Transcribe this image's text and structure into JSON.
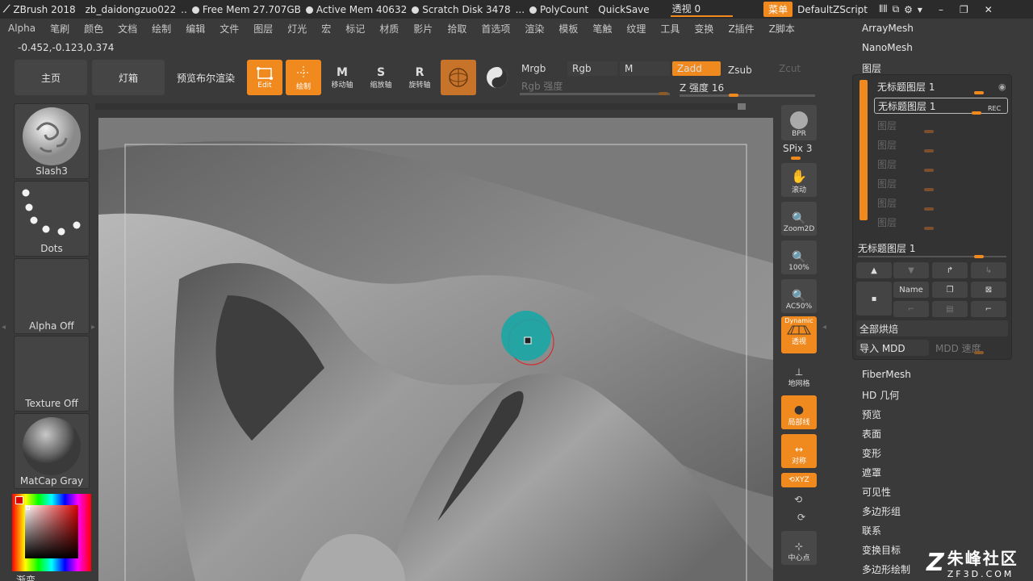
{
  "titlebar": {
    "app": "ZBrush 2018",
    "file": "zb_daidongzuo022",
    "ellipsis": "..",
    "free_mem": "Free Mem 27.707GB",
    "active_mem": "Active Mem 40632",
    "scratch": "Scratch Disk 3478",
    "dots": "...",
    "polycount": "PolyCount",
    "quicksave": "QuickSave",
    "transparency": "透视  0",
    "menu": "菜单",
    "script": "DefaultZScript"
  },
  "menubar": [
    "Alpha",
    "笔刷",
    "颜色",
    "文档",
    "绘制",
    "编辑",
    "文件",
    "图层",
    "灯光",
    "宏",
    "标记",
    "材质",
    "影片",
    "拾取",
    "首选项",
    "渲染",
    "模板",
    "笔触",
    "纹理",
    "工具",
    "变换",
    "Z插件",
    "Z脚本"
  ],
  "coordinates": "-0.452,-0.123,0.374",
  "shelf": {
    "home": "主页",
    "lightbox": "灯箱",
    "preview_bool": "预览布尔渲染",
    "edit": "Edit",
    "draw": "绘制",
    "move": "移动轴",
    "scale": "缩放轴",
    "rotate": "旋转轴",
    "mrgb": "Mrgb",
    "rgb": "Rgb",
    "m": "M",
    "zadd": "Zadd",
    "zsub": "Zsub",
    "zcut": "Zcut",
    "rgb_intensity": "Rgb 强度",
    "z_intensity": "Z 强度 16"
  },
  "left_palette": {
    "brush": "Slash3",
    "stroke": "Dots",
    "alpha": "Alpha Off",
    "texture": "Texture Off",
    "material": "MatCap Gray",
    "gradient": "渐变"
  },
  "right_shelf": {
    "bpr": "BPR",
    "spix": "SPix 3",
    "scroll": "滚动",
    "zoom2d": "Zoom2D",
    "hundred": "100%",
    "ac50": "AC50%",
    "dynamic": "Dynamic",
    "perspective": "透视",
    "floor": "地网格",
    "local": "局部线",
    "symmetry": "对称",
    "xyz": "XYZ",
    "center": "中心点"
  },
  "right_panel": {
    "arraymesh": "ArrayMesh",
    "nanomesh": "NanoMesh",
    "layers_title": "图层",
    "layers": [
      {
        "name": "无标题图层 1",
        "active": true,
        "rec": false
      },
      {
        "name": "无标题图层 1",
        "active": true,
        "rec": true
      },
      {
        "name": "图层",
        "active": false
      },
      {
        "name": "图层",
        "active": false
      },
      {
        "name": "图层",
        "active": false
      },
      {
        "name": "图层",
        "active": false
      },
      {
        "name": "图层",
        "active": false
      },
      {
        "name": "图层",
        "active": false
      }
    ],
    "rec_label": "REC",
    "current_layer": "无标题图层 1",
    "name_btn": "Name",
    "bake_all": "全部烘焙",
    "import_mdd": "导入 MDD",
    "mdd_speed": "MDD 速度",
    "sections": [
      "FiberMesh",
      "HD 几何",
      "预览",
      "表面",
      "变形",
      "遮罩",
      "可见性",
      "多边形组",
      "联系",
      "变换目标",
      "多边形绘制"
    ]
  },
  "watermark": {
    "brand": "朱峰社区",
    "url": "ZF3D.COM"
  },
  "colors": {
    "accent": "#f0891e",
    "brush_cursor": "#1aa6a6"
  }
}
